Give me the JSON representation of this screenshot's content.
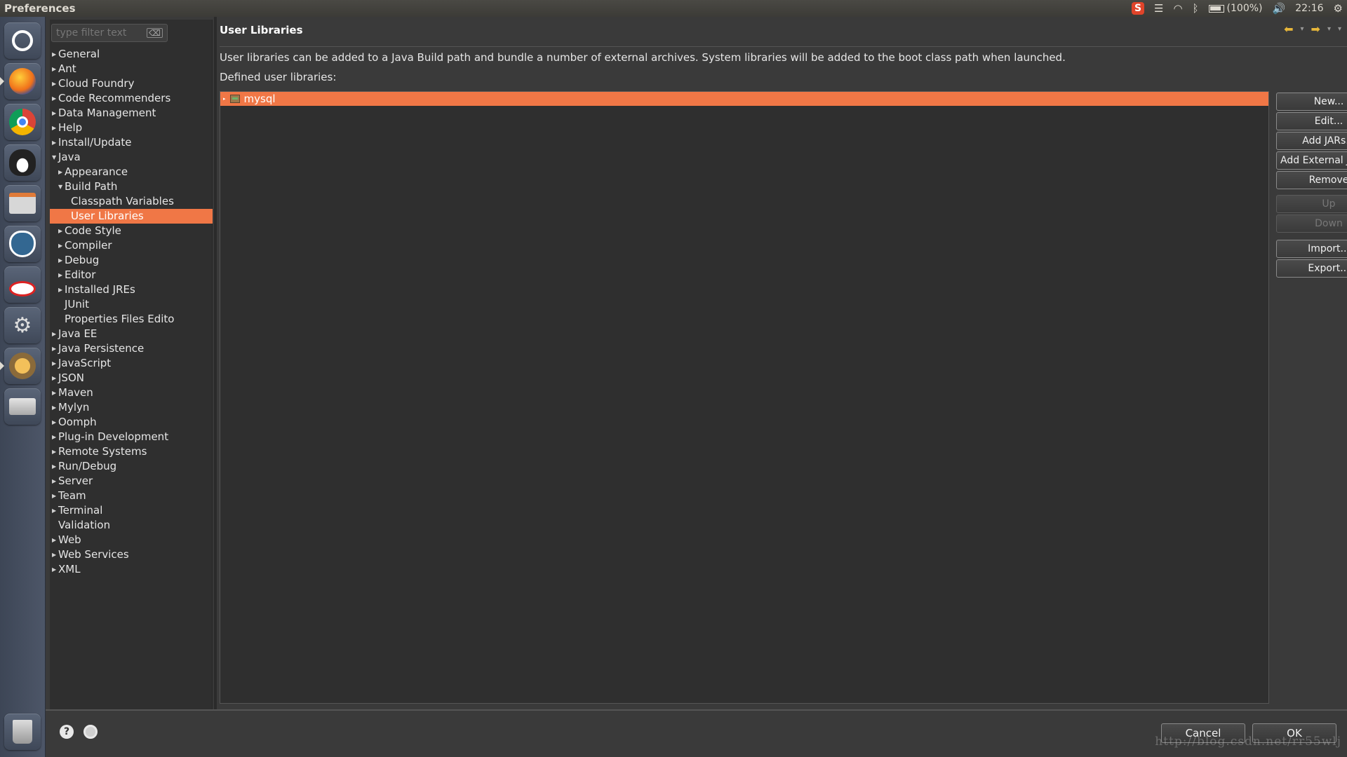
{
  "window": {
    "title": "Preferences"
  },
  "tray": {
    "battery": "(100%)",
    "clock": "22:16"
  },
  "filter": {
    "placeholder": "type filter text"
  },
  "tree": [
    {
      "label": "General",
      "depth": 0,
      "expander": "closed"
    },
    {
      "label": "Ant",
      "depth": 0,
      "expander": "closed"
    },
    {
      "label": "Cloud Foundry",
      "depth": 0,
      "expander": "closed"
    },
    {
      "label": "Code Recommenders",
      "depth": 0,
      "expander": "closed"
    },
    {
      "label": "Data Management",
      "depth": 0,
      "expander": "closed"
    },
    {
      "label": "Help",
      "depth": 0,
      "expander": "closed"
    },
    {
      "label": "Install/Update",
      "depth": 0,
      "expander": "closed"
    },
    {
      "label": "Java",
      "depth": 0,
      "expander": "open"
    },
    {
      "label": "Appearance",
      "depth": 1,
      "expander": "closed"
    },
    {
      "label": "Build Path",
      "depth": 1,
      "expander": "open"
    },
    {
      "label": "Classpath Variables",
      "depth": 2,
      "expander": "none"
    },
    {
      "label": "User Libraries",
      "depth": 2,
      "expander": "none",
      "selected": true
    },
    {
      "label": "Code Style",
      "depth": 1,
      "expander": "closed"
    },
    {
      "label": "Compiler",
      "depth": 1,
      "expander": "closed"
    },
    {
      "label": "Debug",
      "depth": 1,
      "expander": "closed"
    },
    {
      "label": "Editor",
      "depth": 1,
      "expander": "closed"
    },
    {
      "label": "Installed JREs",
      "depth": 1,
      "expander": "closed"
    },
    {
      "label": "JUnit",
      "depth": 1,
      "expander": "none"
    },
    {
      "label": "Properties Files Edito",
      "depth": 1,
      "expander": "none"
    },
    {
      "label": "Java EE",
      "depth": 0,
      "expander": "closed"
    },
    {
      "label": "Java Persistence",
      "depth": 0,
      "expander": "closed"
    },
    {
      "label": "JavaScript",
      "depth": 0,
      "expander": "closed"
    },
    {
      "label": "JSON",
      "depth": 0,
      "expander": "closed"
    },
    {
      "label": "Maven",
      "depth": 0,
      "expander": "closed"
    },
    {
      "label": "Mylyn",
      "depth": 0,
      "expander": "closed"
    },
    {
      "label": "Oomph",
      "depth": 0,
      "expander": "closed"
    },
    {
      "label": "Plug-in Development",
      "depth": 0,
      "expander": "closed"
    },
    {
      "label": "Remote Systems",
      "depth": 0,
      "expander": "closed"
    },
    {
      "label": "Run/Debug",
      "depth": 0,
      "expander": "closed"
    },
    {
      "label": "Server",
      "depth": 0,
      "expander": "closed"
    },
    {
      "label": "Team",
      "depth": 0,
      "expander": "closed"
    },
    {
      "label": "Terminal",
      "depth": 0,
      "expander": "closed"
    },
    {
      "label": "Validation",
      "depth": 0,
      "expander": "none"
    },
    {
      "label": "Web",
      "depth": 0,
      "expander": "closed"
    },
    {
      "label": "Web Services",
      "depth": 0,
      "expander": "closed"
    },
    {
      "label": "XML",
      "depth": 0,
      "expander": "closed"
    }
  ],
  "page": {
    "title": "User Libraries",
    "description": "User libraries can be added to a Java Build path and bundle a number of external archives. System libraries will be added to the boot class path when launched.",
    "list_label": "Defined user libraries:",
    "libraries": [
      {
        "name": "mysql",
        "selected": true
      }
    ]
  },
  "buttons": [
    {
      "label": "New...",
      "enabled": true
    },
    {
      "label": "Edit...",
      "enabled": true
    },
    {
      "label": "Add JARs...",
      "enabled": true
    },
    {
      "label": "Add External JARs...",
      "enabled": true
    },
    {
      "label": "Remove",
      "enabled": true
    },
    {
      "label": "Up",
      "enabled": false
    },
    {
      "label": "Down",
      "enabled": false
    },
    {
      "label": "Import...",
      "enabled": true
    },
    {
      "label": "Export...",
      "enabled": true
    }
  ],
  "footer": {
    "cancel": "Cancel",
    "ok": "OK",
    "help_glyph": "?"
  },
  "watermark": "http://blog.csdn.net/rr55wlj",
  "colors": {
    "selection": "#f07746",
    "accent_arrow": "#e8b73a"
  },
  "launcher": [
    {
      "name": "dash-icon"
    },
    {
      "name": "firefox-icon"
    },
    {
      "name": "chrome-icon"
    },
    {
      "name": "qq-penguin-icon"
    },
    {
      "name": "file-manager-icon"
    },
    {
      "name": "postgresql-elephant-icon"
    },
    {
      "name": "drawing-app-icon"
    },
    {
      "name": "system-settings-icon"
    },
    {
      "name": "java-ee-ide-icon"
    },
    {
      "name": "drive-icon"
    },
    {
      "name": "trash-icon"
    }
  ]
}
